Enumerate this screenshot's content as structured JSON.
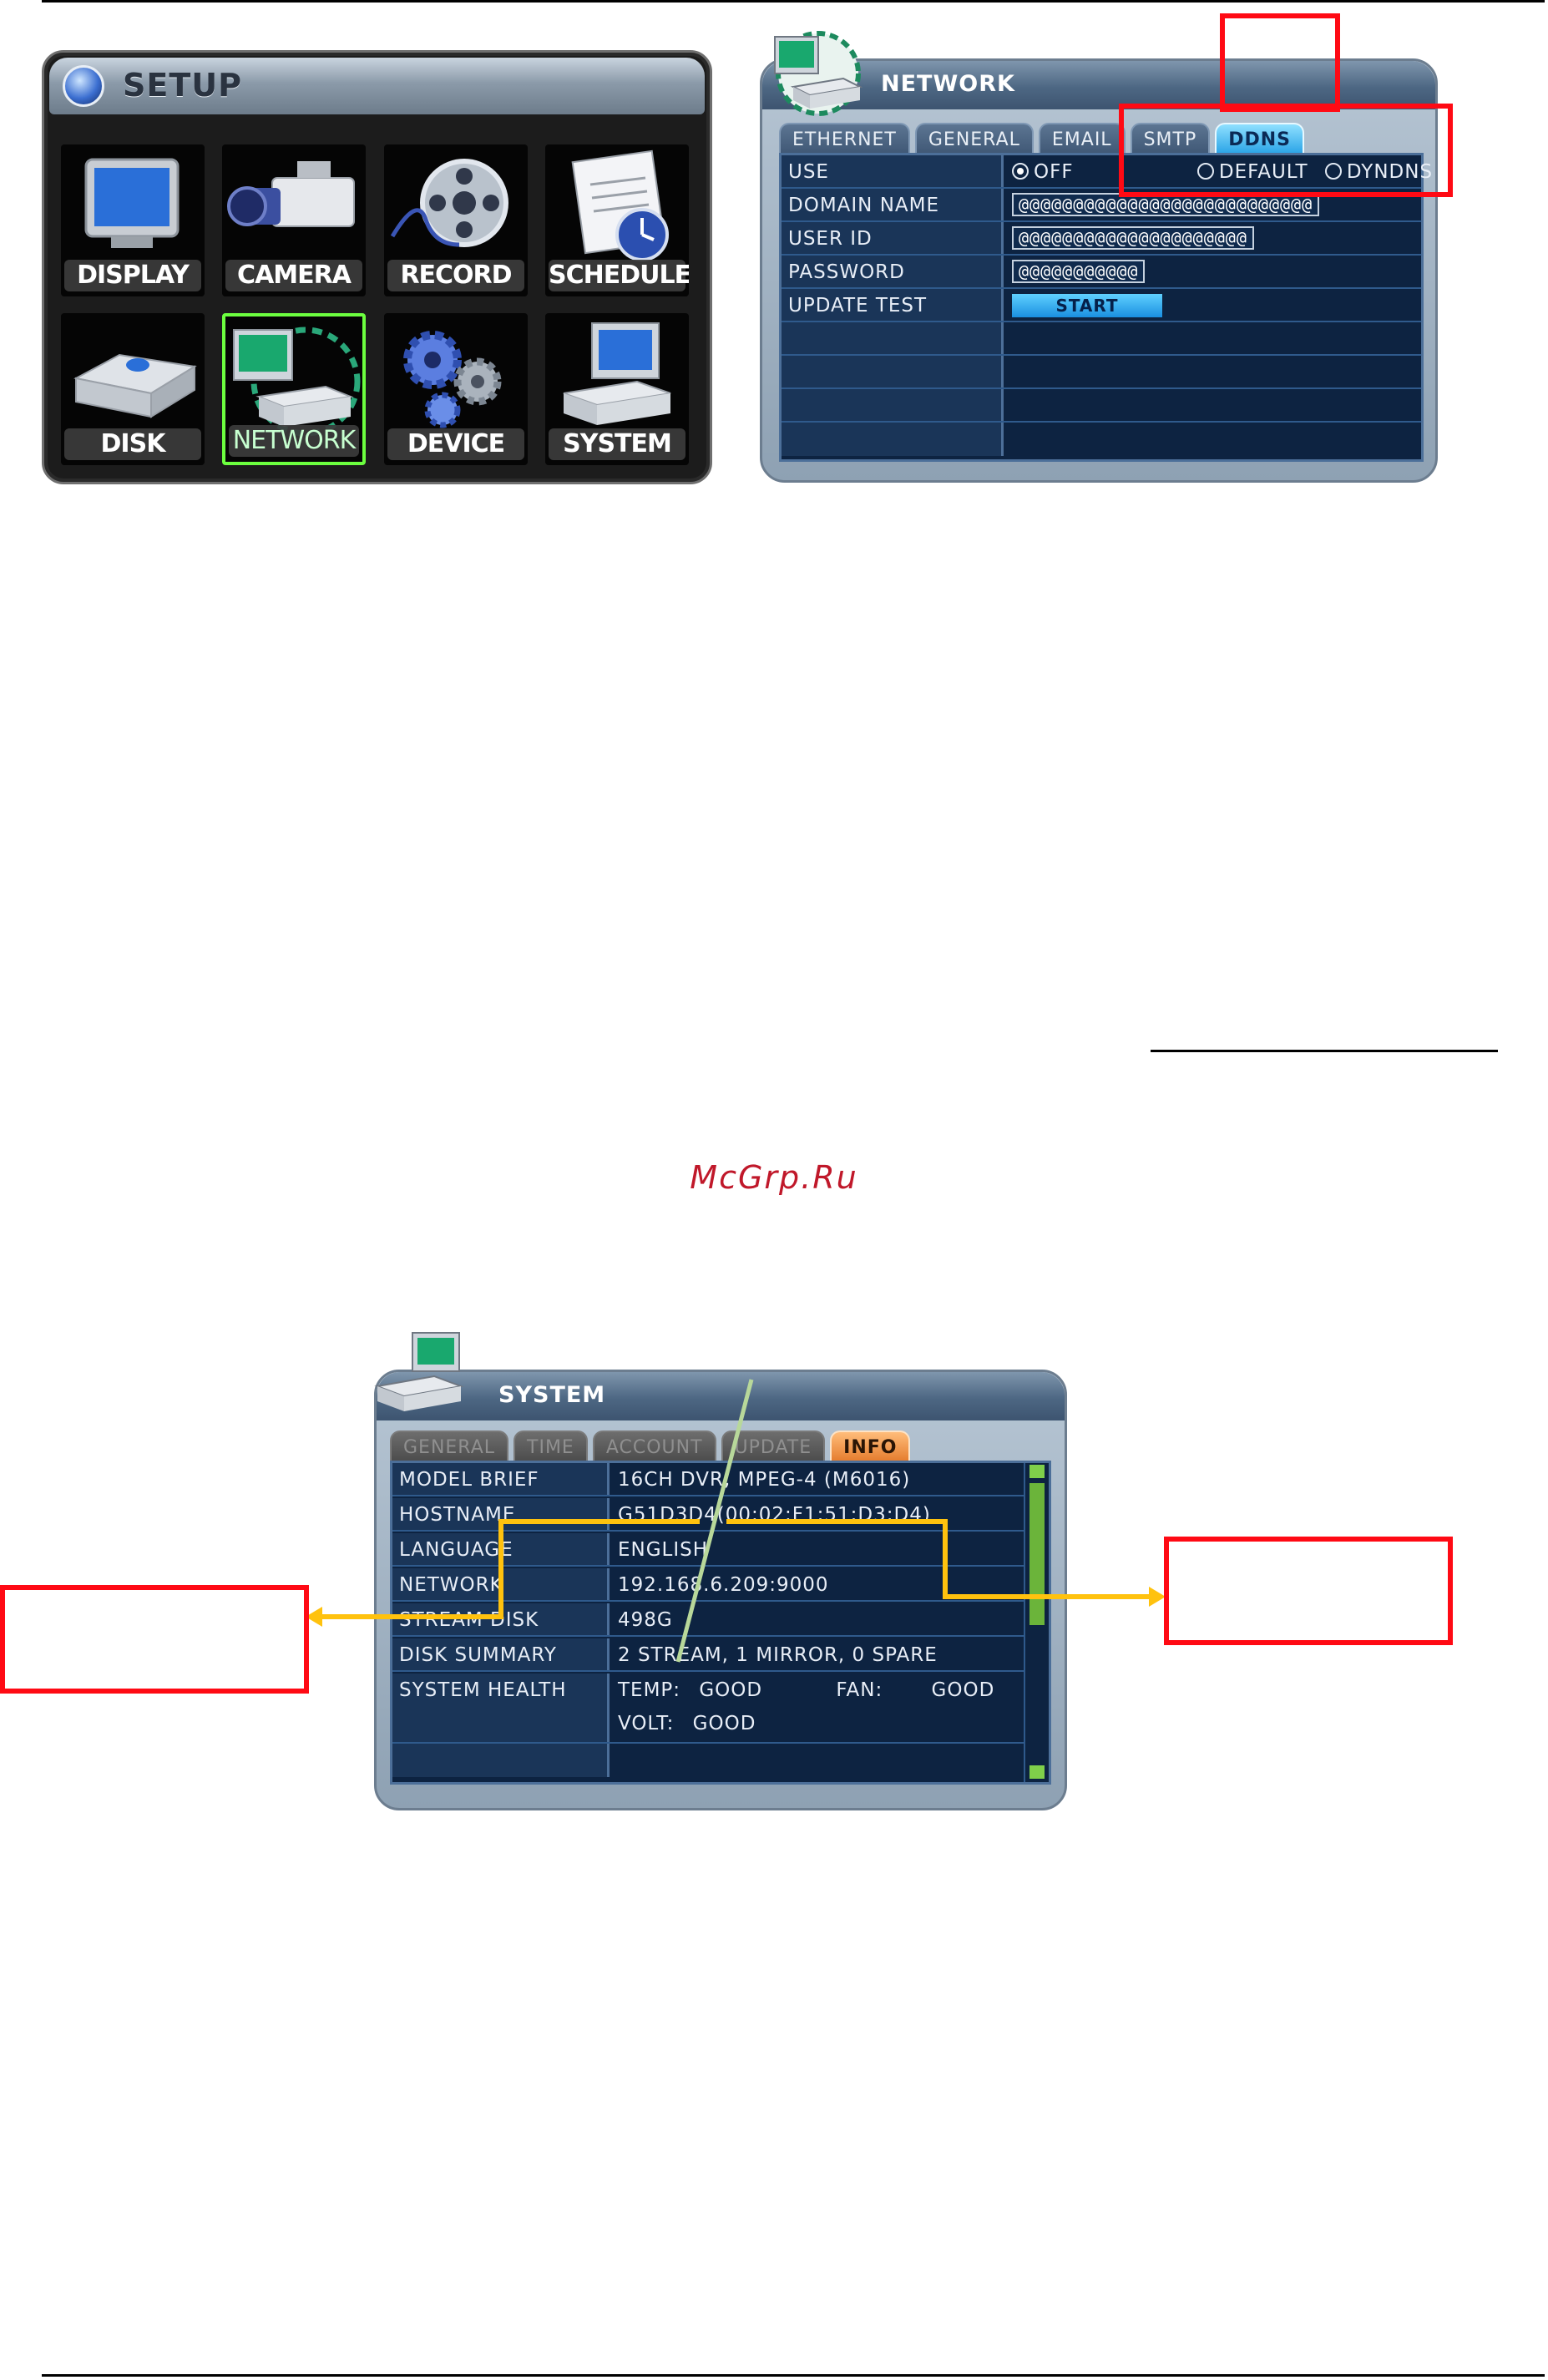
{
  "setup_menu": {
    "title": "SETUP",
    "tiles": [
      {
        "label": "DISPLAY",
        "icon": "display-icon"
      },
      {
        "label": "CAMERA",
        "icon": "camera-icon"
      },
      {
        "label": "RECORD",
        "icon": "record-icon"
      },
      {
        "label": "SCHEDULE",
        "icon": "schedule-icon"
      },
      {
        "label": "DISK",
        "icon": "disk-icon"
      },
      {
        "label": "NETWORK",
        "icon": "network-icon",
        "selected": true
      },
      {
        "label": "DEVICE",
        "icon": "device-icon"
      },
      {
        "label": "SYSTEM",
        "icon": "system-icon"
      }
    ],
    "selected_color": "#6cff3f"
  },
  "network_window": {
    "title": "NETWORK",
    "tabs": [
      "ETHERNET",
      "GENERAL",
      "EMAIL",
      "SMTP",
      "DDNS"
    ],
    "active_tab": "DDNS",
    "rows": [
      {
        "label": "USE",
        "options": [
          "OFF",
          "DEFAULT",
          "DYNDNS"
        ],
        "selected": "OFF"
      },
      {
        "label": "DOMAIN NAME",
        "value": "@@@@@@@@@@@@@@@@@@@@@@@@@@@"
      },
      {
        "label": "USER ID",
        "value": "@@@@@@@@@@@@@@@@@@@@@"
      },
      {
        "label": "PASSWORD",
        "value": "@@@@@@@@@@@"
      },
      {
        "label": "UPDATE TEST",
        "button": "START"
      }
    ]
  },
  "system_window": {
    "title": "SYSTEM",
    "tabs": [
      "GENERAL",
      "TIME",
      "ACCOUNT",
      "UPDATE",
      "INFO"
    ],
    "active_tab": "INFO",
    "rows": [
      {
        "label": "MODEL BRIEF",
        "value": "16CH DVR, MPEG-4 (M6016)"
      },
      {
        "label": "HOSTNAME",
        "value": "G51D3D4(00:02:F1:51:D3:D4)"
      },
      {
        "label": "LANGUAGE",
        "value": "ENGLISH"
      },
      {
        "label": "NETWORK",
        "value": "192.168.6.209:9000"
      },
      {
        "label": "STREAM DISK",
        "value": "498G"
      },
      {
        "label": "DISK SUMMARY",
        "value": "2 STREAM, 1 MIRROR, 0 SPARE"
      }
    ],
    "health": {
      "label": "SYSTEM HEALTH",
      "temp_label": "TEMP:",
      "temp_value": "GOOD",
      "fan_label": "FAN:",
      "fan_value": "GOOD",
      "volt_label": "VOLT:",
      "volt_value": "GOOD"
    }
  },
  "watermark": "McGrp.Ru",
  "colors": {
    "callout_red": "#ff0a14",
    "callout_arrow": "#ffc20e",
    "callout_line": "#b8d89a"
  }
}
